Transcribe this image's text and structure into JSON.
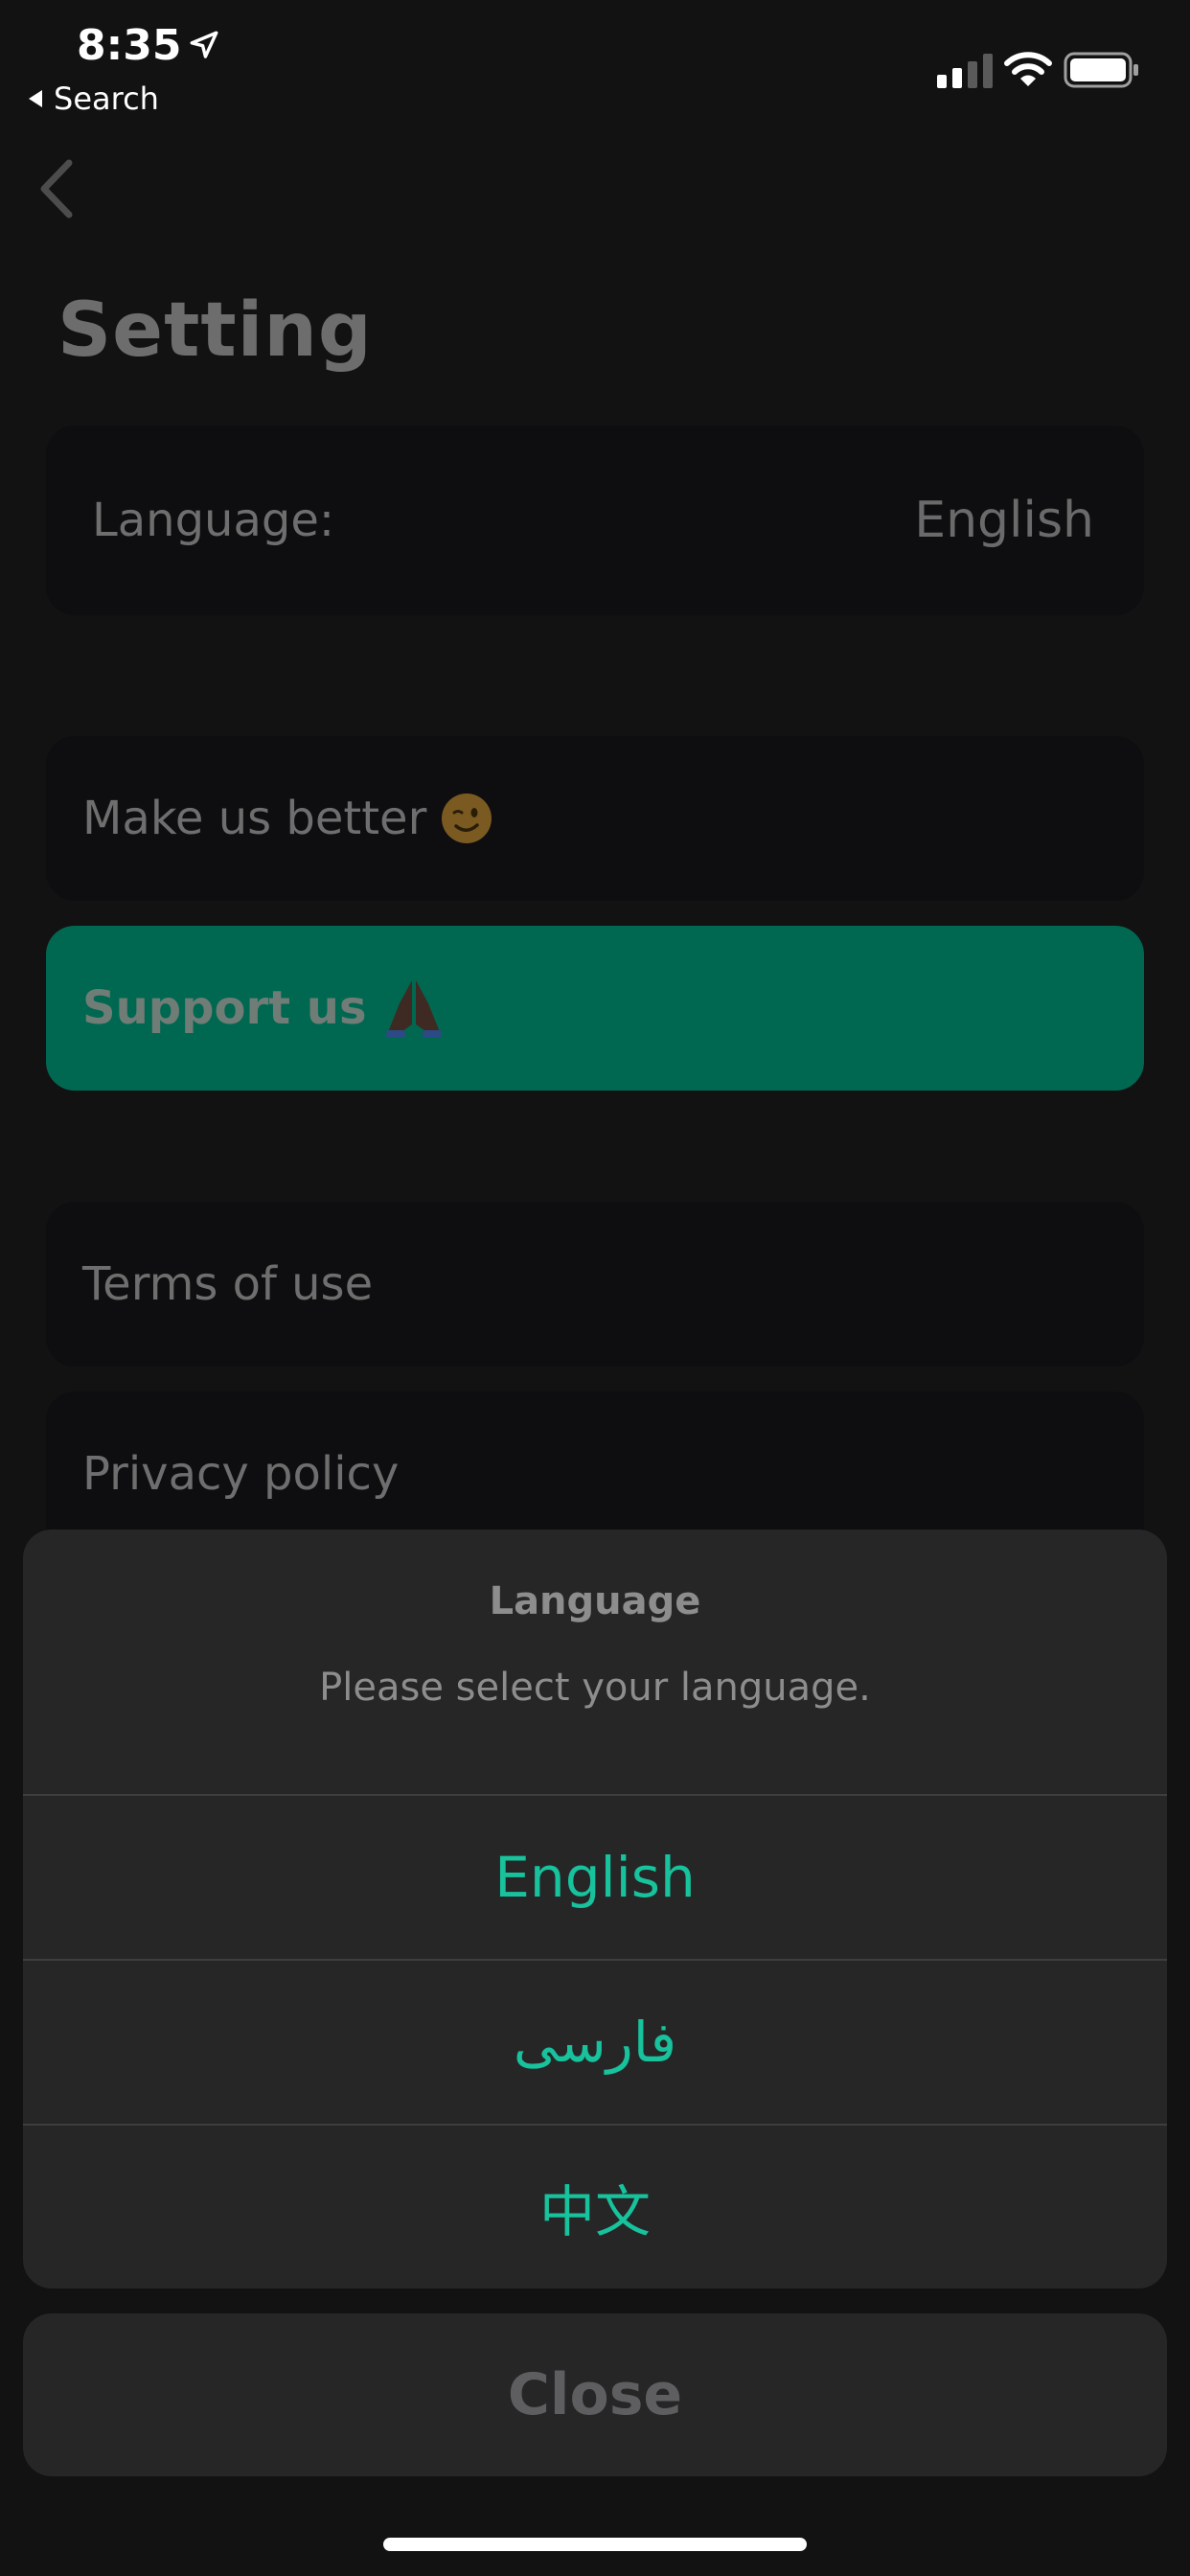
{
  "status_bar": {
    "time": "8:35",
    "back_app_label": "Search",
    "icons": [
      "location-arrow-icon",
      "cellular-signal-icon",
      "wifi-icon",
      "battery-icon"
    ]
  },
  "page": {
    "back_icon": "chevron-left-icon",
    "title": "Setting",
    "language_row": {
      "label": "Language:",
      "value": "English"
    },
    "make_better": {
      "label": "Make us better",
      "emoji": "winking-face-icon"
    },
    "support": {
      "label": "Support us",
      "emoji": "folded-hands-icon",
      "color": "#006851"
    },
    "terms": {
      "label": "Terms of use"
    },
    "privacy": {
      "label": "Privacy policy"
    }
  },
  "action_sheet": {
    "title": "Language",
    "message": "Please select your language.",
    "options": [
      {
        "label": "English"
      },
      {
        "label": "فارسی"
      },
      {
        "label": "中文"
      }
    ],
    "accent": "#17c29c",
    "close_label": "Close"
  }
}
